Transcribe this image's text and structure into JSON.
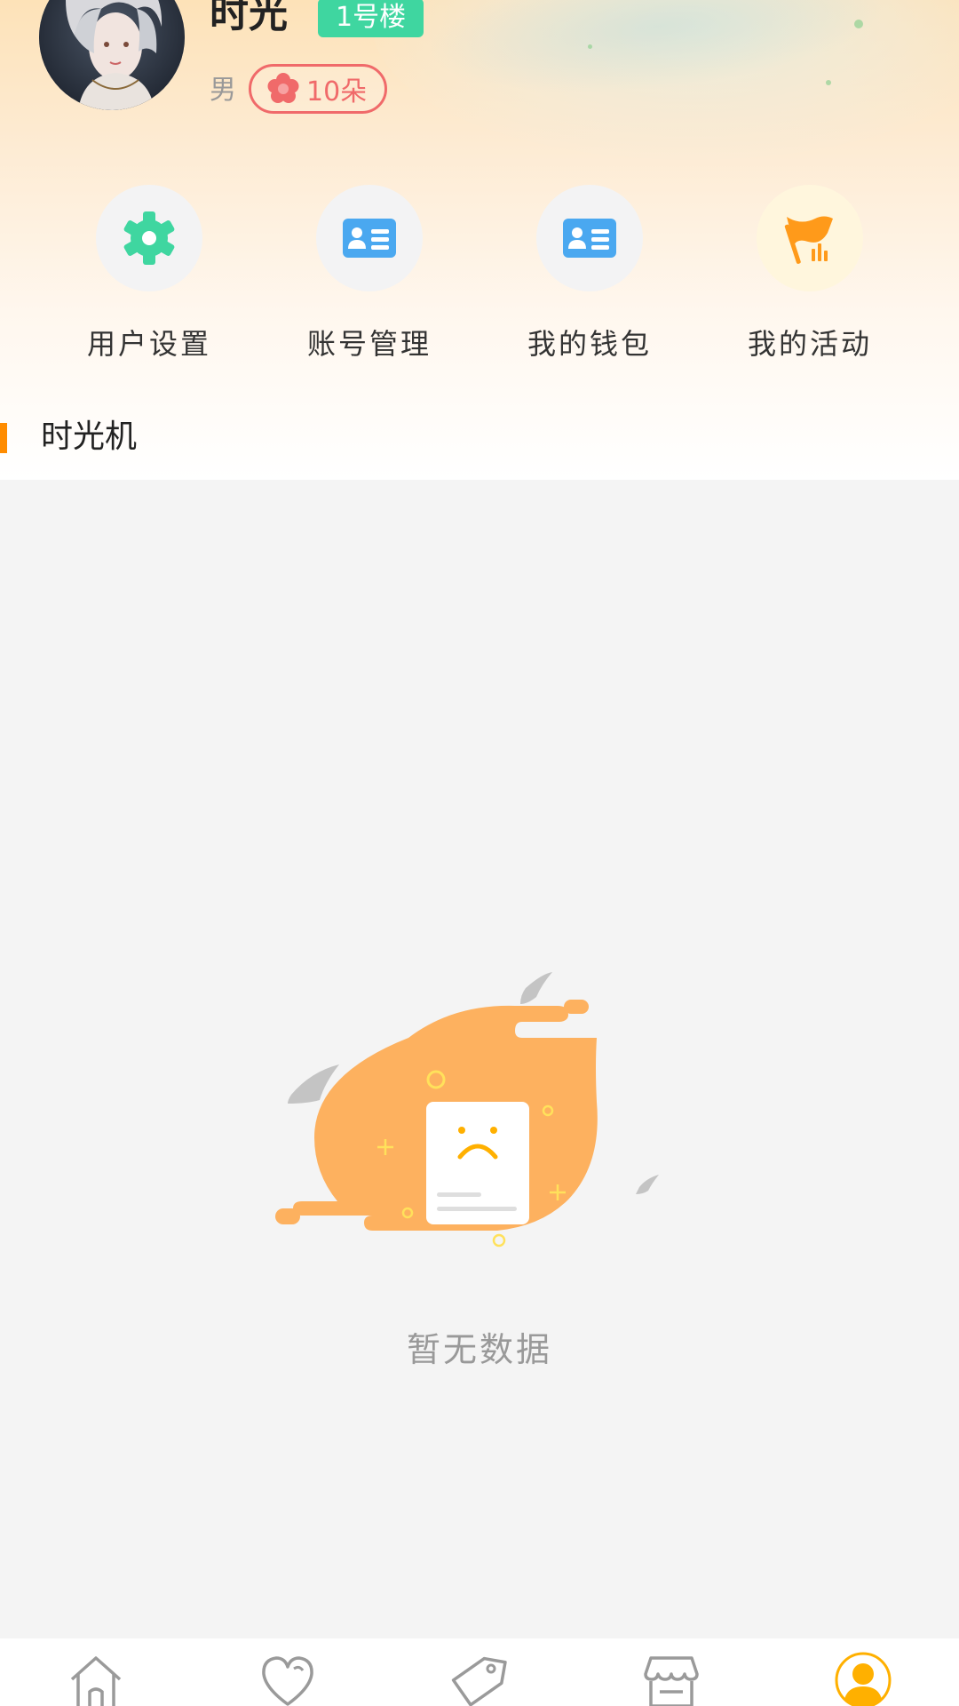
{
  "profile": {
    "name": "时光",
    "building_badge": "1号楼",
    "gender": "男",
    "flowers": "10朵",
    "avatar_icon": "user-avatar-photo"
  },
  "actions": [
    {
      "label": "用户设置",
      "icon": "gear-icon"
    },
    {
      "label": "账号管理",
      "icon": "id-card-icon"
    },
    {
      "label": "我的钱包",
      "icon": "id-card-icon"
    },
    {
      "label": "我的活动",
      "icon": "flag-chart-icon"
    }
  ],
  "section": {
    "title": "时光机"
  },
  "empty_state": {
    "text": "暂无数据",
    "icon": "empty-sad-document-illustration"
  },
  "tabbar": {
    "tabs": [
      {
        "name": "home",
        "icon": "home-icon",
        "active": false
      },
      {
        "name": "favorites",
        "icon": "heart-icon",
        "active": false
      },
      {
        "name": "tags",
        "icon": "tag-icon",
        "active": false
      },
      {
        "name": "store",
        "icon": "store-icon",
        "active": false
      },
      {
        "name": "me",
        "icon": "user-icon",
        "active": true
      }
    ]
  },
  "colors": {
    "accent": "#ff8c00",
    "badge_green": "#3fd6a0",
    "flower_red": "#f06a6a",
    "empty_orange": "#fdb15f",
    "tab_active": "#ffb000",
    "tab_inactive": "#9a9a9a"
  }
}
